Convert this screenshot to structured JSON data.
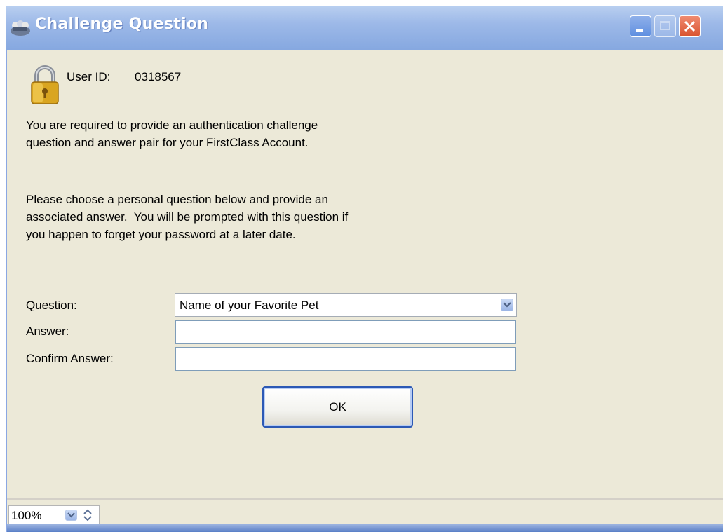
{
  "window": {
    "title": "Challenge Question",
    "controls": [
      "minimize",
      "maximize",
      "close"
    ]
  },
  "account": {
    "user_id_label": "User ID:",
    "user_id_value": "0318567"
  },
  "messages": {
    "intro_line1": "You are required to provide an authentication challenge",
    "intro_line2": "question and answer pair for your FirstClass Account.",
    "instr_line1": "Please choose a personal question below and provide an",
    "instr_line2": "associated answer.  You will be prompted with this question if",
    "instr_line3": "you happen to forget your password at a later date."
  },
  "form": {
    "question_label": "Question:",
    "question_selected": "Name of your Favorite Pet",
    "answer_label": "Answer:",
    "answer_value": "",
    "confirm_label": "Confirm Answer:",
    "confirm_value": "",
    "ok_label": "OK"
  },
  "statusbar": {
    "zoom_value": "100%"
  },
  "icons": {
    "app": "firstclass-app-icon",
    "lock": "padlock-icon",
    "dropdown": "chevron-down-icon",
    "stepper": "up-down-arrows-icon"
  },
  "colors": {
    "titlebar": "#9db9e8",
    "window_bg": "#ece9d8",
    "close_button": "#d9532f",
    "ok_border": "#2c59b5"
  }
}
